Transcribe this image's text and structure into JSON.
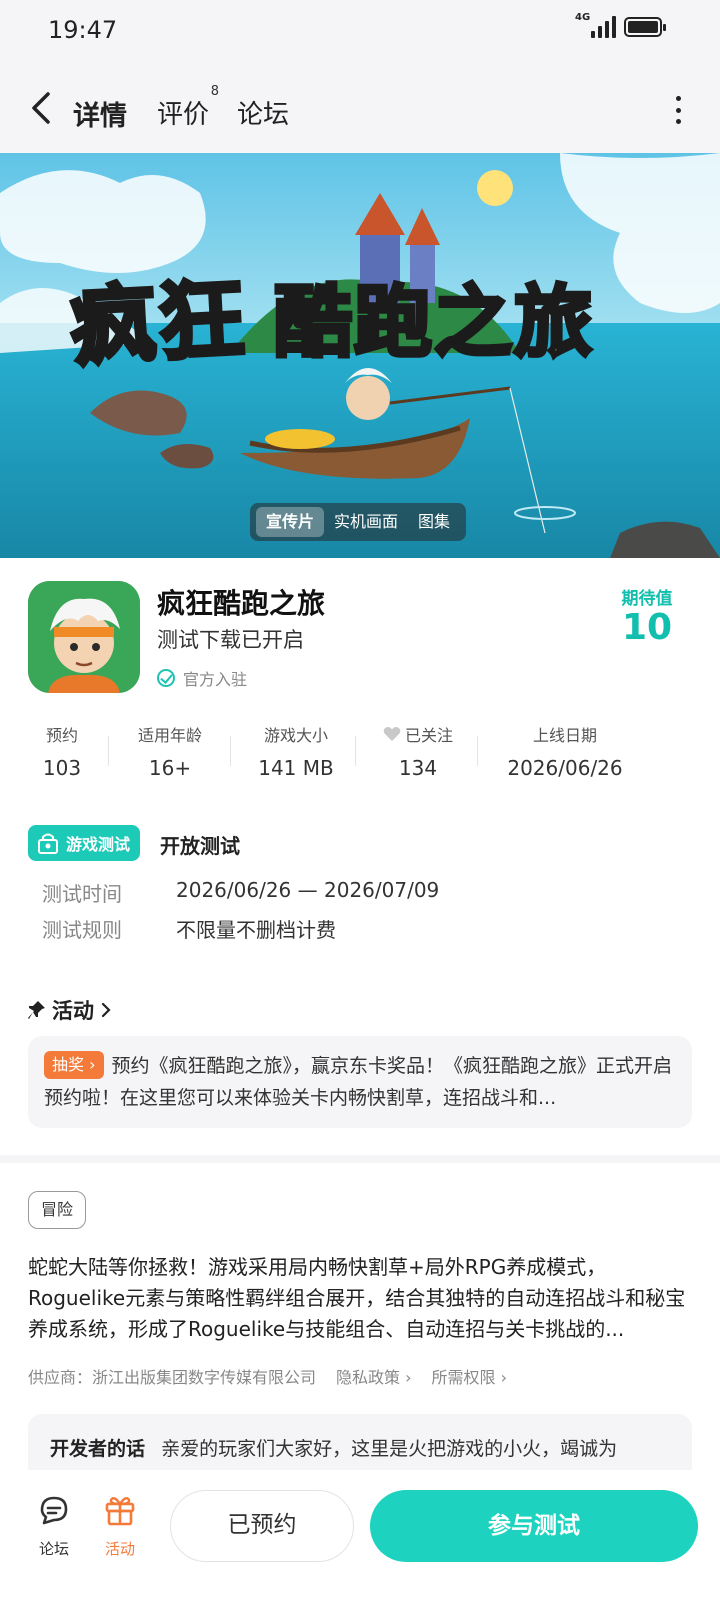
{
  "status_bar": {
    "time": "19:47",
    "network": "4G"
  },
  "nav": {
    "tabs": [
      {
        "label": "详情",
        "active": true
      },
      {
        "label": "评价",
        "badge": "8"
      },
      {
        "label": "论坛"
      }
    ]
  },
  "banner": {
    "title_yellow": "疯狂",
    "title_white": "酷跑之旅",
    "media_tabs": [
      "宣传片",
      "实机画面",
      "图集"
    ],
    "active_media_tab": "宣传片"
  },
  "app": {
    "name": "疯狂酷跑之旅",
    "subtitle": "测试下载已开启",
    "official_label": "官方入驻",
    "expect_label": "期待值",
    "expect_value": "10",
    "accent_color": "#12bfae"
  },
  "stats": [
    {
      "key": "预约",
      "value": "103"
    },
    {
      "key": "适用年龄",
      "value": "16+"
    },
    {
      "key": "游戏大小",
      "value": "141 MB"
    },
    {
      "key": "已关注",
      "value": "134",
      "icon": "heart-icon"
    },
    {
      "key": "上线日期",
      "value": "2026/06/26"
    }
  ],
  "test": {
    "badge": "游戏测试",
    "title": "开放测试",
    "rows": [
      {
        "label": "测试时间",
        "value": "2026/06/26 — 2026/07/09"
      },
      {
        "label": "测试规则",
        "value": "不限量不删档计费"
      }
    ]
  },
  "activity": {
    "header": "活动",
    "badge": "抽奖",
    "text": "预约《疯狂酷跑之旅》，赢京东卡奖品！《疯狂酷跑之旅》正式开启预约啦！在这里您可以来体验关卡内畅快割草，连招战斗和..."
  },
  "details": {
    "tag": "冒险",
    "description": "蛇蛇大陆等你拯救！游戏采用局内畅快割草+局外RPG养成模式，Roguelike元素与策略性羁绊组合展开，结合其独特的自动连招战斗和秘宝养成系统，形成了Roguelike与技能组合、自动连招与关卡挑战的...",
    "supplier": "供应商：浙江出版集团数字传媒有限公司",
    "privacy": "隐私政策",
    "permissions": "所需权限"
  },
  "developer": {
    "label": "开发者的话",
    "text": "亲爱的玩家们大家好，这里是火把游戏的小火，竭诚为"
  },
  "bottom_bar": {
    "forum": "论坛",
    "activity": "活动",
    "reserved": "已预约",
    "join": "参与测试"
  }
}
